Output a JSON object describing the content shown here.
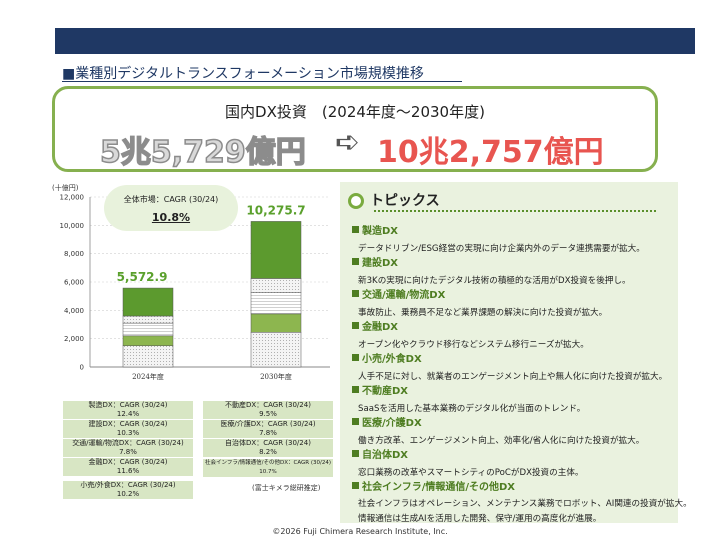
{
  "page_title": "■業種別デジタルトランスフォーメーション市場規模推移",
  "banner": {
    "subtitle": "国内DX投資　(2024年度～2030年度)",
    "from_value": "5兆5,729億円",
    "arrow": "➪",
    "to_value": "10兆2,757億円"
  },
  "chart_data": {
    "type": "bar",
    "stacked": true,
    "unit_label": "(十億円)",
    "categories": [
      "2024年度",
      "2030年度"
    ],
    "totals": [
      5572.9,
      10275.7
    ],
    "total_labels": [
      "5,572.9",
      "10,275.7"
    ],
    "ylim": [
      0,
      12000
    ],
    "yticks": [
      "0",
      "2,000",
      "4,000",
      "6,000",
      "8,000",
      "10,000",
      "12,000"
    ],
    "grid": true,
    "series": [
      {
        "values": [
          1500,
          2450
        ],
        "color": "#f2f2f2",
        "pattern": "dots"
      },
      {
        "values": [
          700,
          1300
        ],
        "color": "#8db64f"
      },
      {
        "values": [
          900,
          1500
        ],
        "color": "#ffffff",
        "pattern": "stripes"
      },
      {
        "values": [
          500,
          1000
        ],
        "color": "#d9d9d9",
        "pattern": "dots"
      },
      {
        "values": [
          1972.9,
          4025.7
        ],
        "color": "#5c9a2e"
      }
    ],
    "overall": {
      "label": "全体市場：CAGR (30/24)",
      "value": "10.8%"
    }
  },
  "legend": [
    {
      "name": "製造DX：CAGR (30/24)",
      "value": "12.4%"
    },
    {
      "name": "建設DX：CAGR (30/24)",
      "value": "10.3%"
    },
    {
      "name": "交通/運輸/物流DX：CAGR (30/24)",
      "value": "7.8%"
    },
    {
      "name": "金融DX：CAGR (30/24)",
      "value": "11.6%"
    },
    {
      "name": "小売/外食DX：CAGR (30/24)",
      "value": "10.2%"
    },
    {
      "name": "不動産DX：CAGR (30/24)",
      "value": "9.5%"
    },
    {
      "name": "医療/介護DX：CAGR (30/24)",
      "value": "7.8%"
    },
    {
      "name": "自治体DX：CAGR (30/24)",
      "value": "8.2%"
    },
    {
      "name": "社会インフラ/情報通信/その他DX：CAGR (30/24)",
      "value": "10.7%"
    }
  ],
  "source": "(富士キメラ総研推定)",
  "topics": {
    "heading": "トピックス",
    "items": [
      {
        "title": "製造DX",
        "lines": [
          "データドリブン/ESG経営の実現に向け企業内外のデータ連携需要が拡大。"
        ]
      },
      {
        "title": "建設DX",
        "lines": [
          "新3Kの実現に向けたデジタル技術の積極的な活用がDX投資を後押し。"
        ]
      },
      {
        "title": "交通/運輸/物流DX",
        "lines": [
          "事故防止、乗務員不足など業界課題の解決に向けた投資が拡大。"
        ]
      },
      {
        "title": "金融DX",
        "lines": [
          "オープン化やクラウド移行などシステム移行ニーズが拡大。"
        ]
      },
      {
        "title": "小売/外食DX",
        "lines": [
          "人手不足に対し、就業者のエンゲージメント向上や無人化に向けた投資が拡大。"
        ]
      },
      {
        "title": "不動産DX",
        "lines": [
          "SaaSを活用した基本業務のデジタル化が当面のトレンド。"
        ]
      },
      {
        "title": "医療/介護DX",
        "lines": [
          "働き方改革、エンゲージメント向上、効率化/省人化に向けた投資が拡大。"
        ]
      },
      {
        "title": "自治体DX",
        "lines": [
          "窓口業務の改革やスマートシティのPoCがDX投資の主体。"
        ]
      },
      {
        "title": "社会インフラ/情報通信/その他DX",
        "lines": [
          "社会インフラはオペレーション、メンテナンス業務でロボット、AI関連の投資が拡大。",
          "情報通信は生成AIを活用した開発、保守/運用の高度化が進展。"
        ]
      }
    ]
  },
  "copyright": "©2026 Fuji Chimera Research Institute, Inc."
}
